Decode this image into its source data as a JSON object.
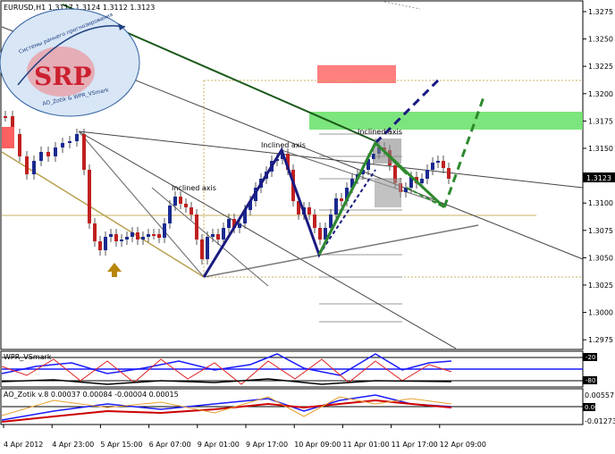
{
  "chart": {
    "symbol_header": "EURUSD,H1  1.3117 1.3124 1.3112 1.3123",
    "current_price_label": "1.3123",
    "price_ticks": [
      "1.3275",
      "1.3250",
      "1.3225",
      "1.3200",
      "1.3175",
      "1.3150",
      "1.3125",
      "1.3100",
      "1.3075",
      "1.3050",
      "1.3025",
      "1.3000",
      "1.2975"
    ],
    "time_ticks": [
      "4 Apr 2012",
      "4 Apr 23:00",
      "5 Apr 15:00",
      "6 Apr 07:00",
      "9 Apr 01:00",
      "9 Apr 17:00",
      "10 Apr 09:00",
      "11 Apr 01:00",
      "11 Apr 17:00",
      "12 Apr 09:00"
    ],
    "inclined_axis_label": "Inclined axis"
  },
  "logo": {
    "letters": "SRP",
    "ring_text": "Системы раннего прогнозирования",
    "bottom_text": "AO_Zotik & WPR_VSmark"
  },
  "wpr_panel": {
    "title": "WPR_VSmark",
    "level_high": "-20",
    "level_low": "-80"
  },
  "ao_panel": {
    "title": "AO_Zotik v.8 0.00037 0.00084 -0.00004 0.00015",
    "ticks": [
      "0.00557",
      "0.00",
      "-0.01273"
    ]
  },
  "colors": {
    "blue_wave": "#1a1a80",
    "green_wave": "#2d8a2d",
    "up_arrow": "#b8860b",
    "red_zone": "#ff6666",
    "green_zone": "#66dd66"
  }
}
